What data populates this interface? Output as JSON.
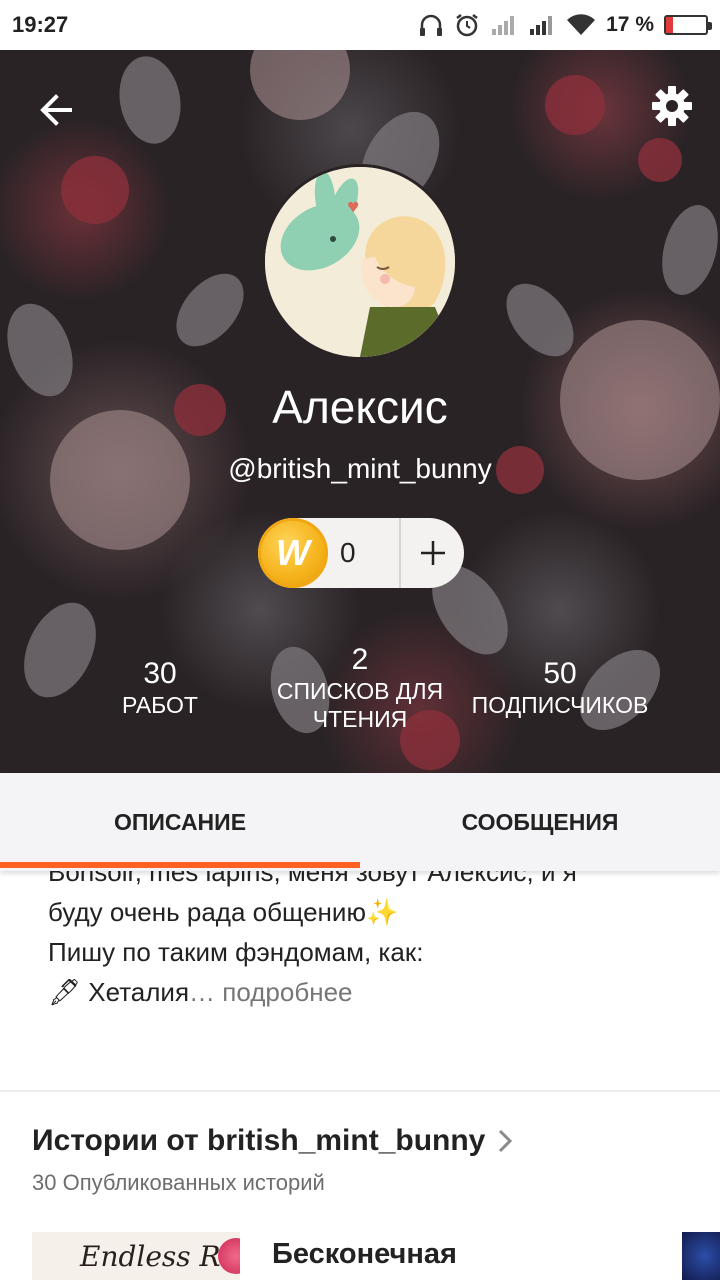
{
  "status_bar": {
    "time": "19:27",
    "battery_percent_label": "17 %",
    "battery_level": 0.17,
    "battery_color": "#e03a3a"
  },
  "header": {
    "back_icon": "arrow-left-icon",
    "settings_icon": "gear-icon"
  },
  "profile": {
    "name": "Алексис",
    "handle": "@british_mint_bunny",
    "coins": {
      "symbol": "W",
      "count": "0",
      "add_label": "+"
    },
    "stats": [
      {
        "value": "30",
        "label_line1": "РАБОТ",
        "label_line2": ""
      },
      {
        "value": "2",
        "label_line1": "СПИСКОВ ДЛЯ",
        "label_line2": "ЧТЕНИЯ"
      },
      {
        "value": "50",
        "label_line1": "ПОДПИСЧИКОВ",
        "label_line2": ""
      }
    ]
  },
  "tabs": {
    "items": [
      {
        "label": "ОПИСАНИЕ",
        "active": true
      },
      {
        "label": "СООБЩЕНИЯ",
        "active": false
      }
    ],
    "accent_color": "#ff6122"
  },
  "description": {
    "line1": "Bonsoir, mes lapins, меня зовут Алексис, и я",
    "line2": "буду очень рада общению",
    "line2_emoji": "✨",
    "line3": "Пишу по таким фэндомам, как:",
    "line4_emoji": "🖋",
    "line4": "Хеталия",
    "more_label": "… подробнее"
  },
  "stories": {
    "title": "Истории от british_mint_bunny",
    "subtitle": "30 Опубликованных историй",
    "items": [
      {
        "cover_text": "Endless Romance",
        "title": "Бесконечная"
      }
    ]
  }
}
